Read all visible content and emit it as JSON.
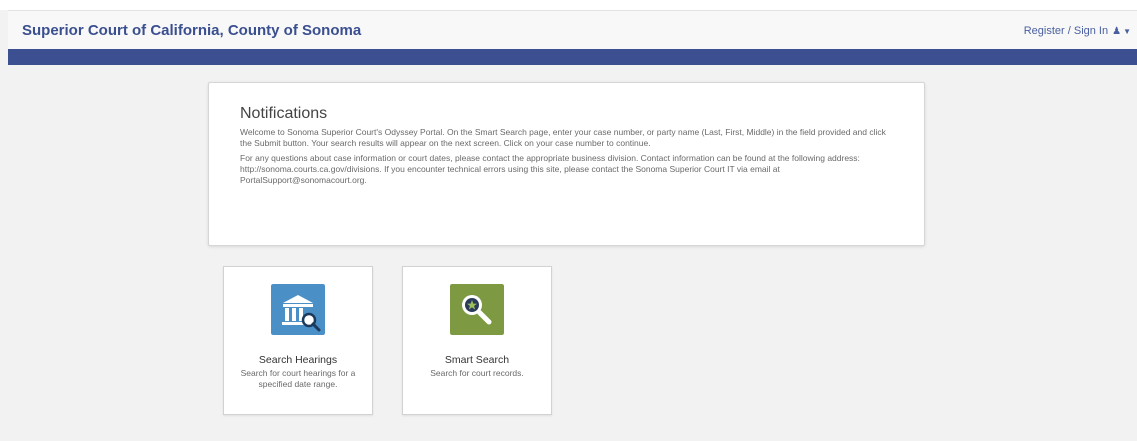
{
  "header": {
    "title": "Superior Court of California, County of Sonoma",
    "signin_label": "Register / Sign In",
    "signin_icon": "user-icon",
    "caret_icon": "caret-down-icon"
  },
  "colors": {
    "brand": "#3a4f8f",
    "bar": "#3c4f91",
    "hearings_icon_bg": "#4b8fc7",
    "smart_icon_bg": "#7d9a43"
  },
  "notifications": {
    "heading": "Notifications",
    "paragraphs": [
      "Welcome to Sonoma Superior Court's Odyssey Portal. On the Smart Search page, enter your case number, or party name (Last, First, Middle) in the field provided and click the Submit button. Your search results will appear on the next screen. Click on your case number to continue.",
      "For any questions about case information or court dates, please contact the appropriate business division. Contact information can be found at the following address: http://sonoma.courts.ca.gov/divisions. If you encounter technical errors using this site, please contact the Sonoma Superior Court IT via email at PortalSupport@sonomacourt.org."
    ]
  },
  "tiles": [
    {
      "title": "Search Hearings",
      "description": "Search for court hearings for a specified date range.",
      "icon": "courthouse-search-icon"
    },
    {
      "title": "Smart Search",
      "description": "Search for court records.",
      "icon": "magnifier-star-icon"
    }
  ]
}
